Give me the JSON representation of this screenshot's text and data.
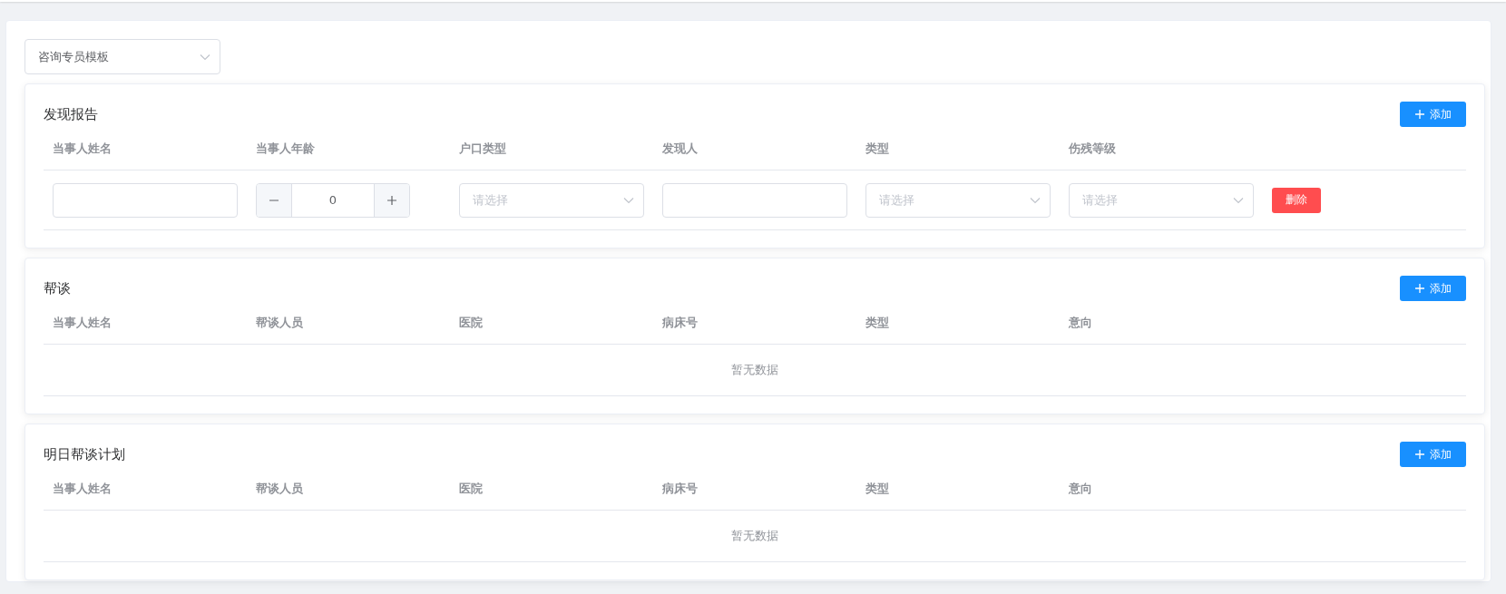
{
  "template_select": {
    "value": "咨询专员模板"
  },
  "sections": [
    {
      "title": "发现报告",
      "add_button": "添加",
      "columns": [
        "当事人姓名",
        "当事人年龄",
        "户口类型",
        "发现人",
        "类型",
        "伤残等级"
      ],
      "rows": [
        {
          "cells": [
            {
              "kind": "text-input"
            },
            {
              "kind": "stepper",
              "value": "0"
            },
            {
              "kind": "select",
              "placeholder": "请选择"
            },
            {
              "kind": "text-input"
            },
            {
              "kind": "select",
              "placeholder": "请选择"
            },
            {
              "kind": "select",
              "placeholder": "请选择"
            }
          ],
          "delete_button": "删除"
        }
      ]
    },
    {
      "title": "帮谈",
      "add_button": "添加",
      "columns": [
        "当事人姓名",
        "帮谈人员",
        "医院",
        "病床号",
        "类型",
        "意向"
      ],
      "empty_text": "暂无数据"
    },
    {
      "title": "明日帮谈计划",
      "add_button": "添加",
      "columns": [
        "当事人姓名",
        "帮谈人员",
        "医院",
        "病床号",
        "类型",
        "意向"
      ],
      "empty_text": "暂无数据"
    }
  ]
}
